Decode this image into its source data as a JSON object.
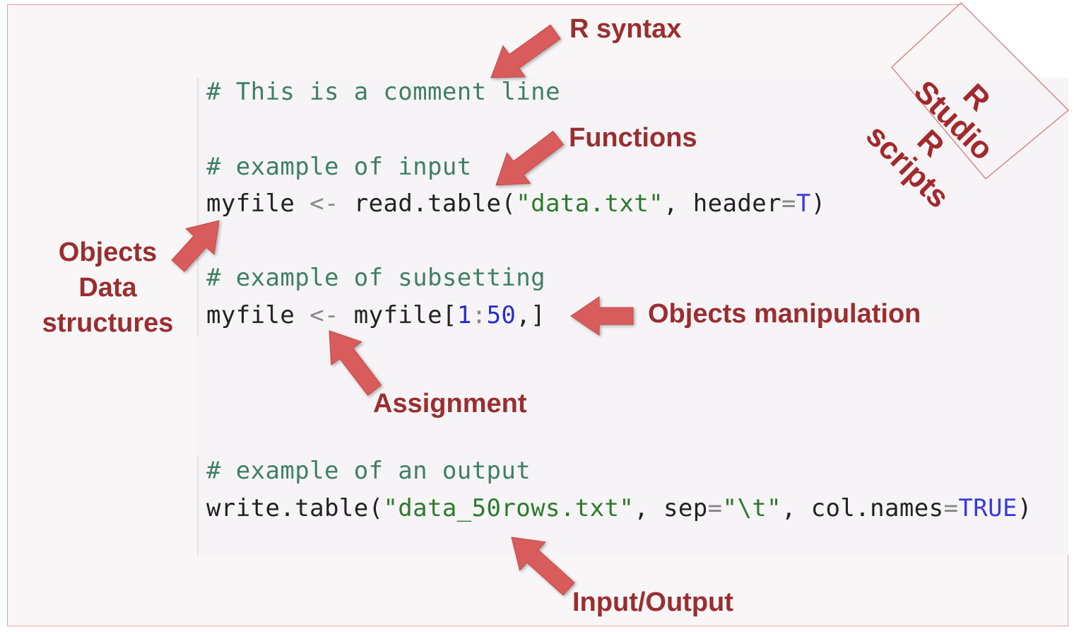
{
  "code": {
    "line1": "# This is a comment line",
    "line2": "# example of input",
    "line3": {
      "obj": "myfile",
      "assign": "<-",
      "fn": "read.table(",
      "str": "\"data.txt\"",
      "sep": ", header",
      "eq": "=",
      "val": "T",
      "close": ")"
    },
    "line4": "# example of subsetting",
    "line5": {
      "obj": "myfile",
      "assign": "<-",
      "rest": "myfile[",
      "num1": "1",
      "colon": ":",
      "num2": "50",
      "end": ",]"
    },
    "line6": "# example of an output",
    "line7": {
      "fn": "write.table(",
      "str1": "\"data_50rows.txt\"",
      "mid": ", sep",
      "eq1": "=",
      "str2": "\"\\t\"",
      "mid2": ", col.names",
      "eq2": "=",
      "val": "TRUE",
      "close": ")"
    }
  },
  "labels": {
    "r_syntax": "R syntax",
    "functions": "Functions",
    "objects_l1": "Objects",
    "objects_l2": "Data",
    "objects_l3": "structures",
    "objects_manipulation": "Objects manipulation",
    "assignment": "Assignment",
    "input_output": "Input/Output"
  },
  "corner_tag": {
    "line1": "R",
    "line2": "Studio",
    "line3": "R",
    "line4": "scripts"
  },
  "colors": {
    "label": "#9a2e30",
    "arrow_fill": "#d95b5b",
    "comment": "#3f7f63",
    "string": "#2d7a2d",
    "number": "#2a2ad0"
  }
}
